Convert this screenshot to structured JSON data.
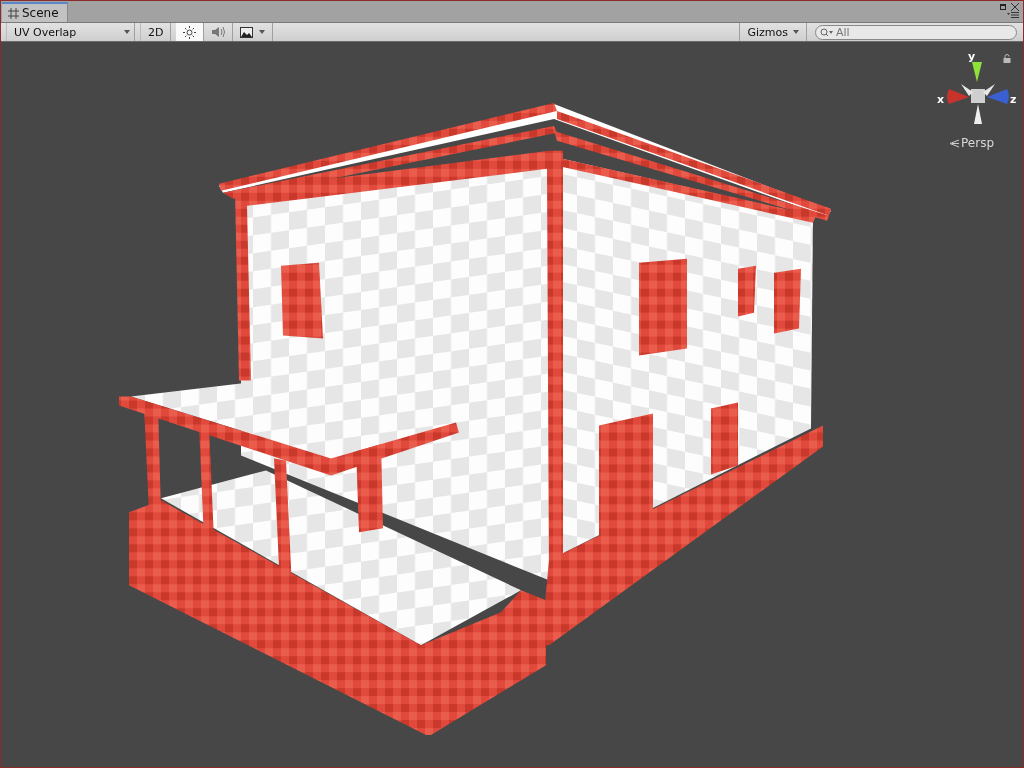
{
  "tab": {
    "title": "Scene",
    "selected": true
  },
  "toolbar": {
    "draw_mode": "UV Overlap",
    "mode_2d": {
      "label": "2D",
      "selected": false
    },
    "toggles": [
      {
        "kind": "lighting",
        "selected": true
      },
      {
        "kind": "audio",
        "selected": false
      },
      {
        "kind": "effects",
        "selected": false
      }
    ],
    "gizmos": "Gizmos",
    "search": {
      "placeholder": "All"
    }
  },
  "orientation_gizmo": {
    "axes": [
      {
        "kind": "y",
        "label": "y"
      },
      {
        "kind": "x",
        "label": "x"
      },
      {
        "kind": "z",
        "label": "z"
      }
    ],
    "projection": "Persp"
  }
}
